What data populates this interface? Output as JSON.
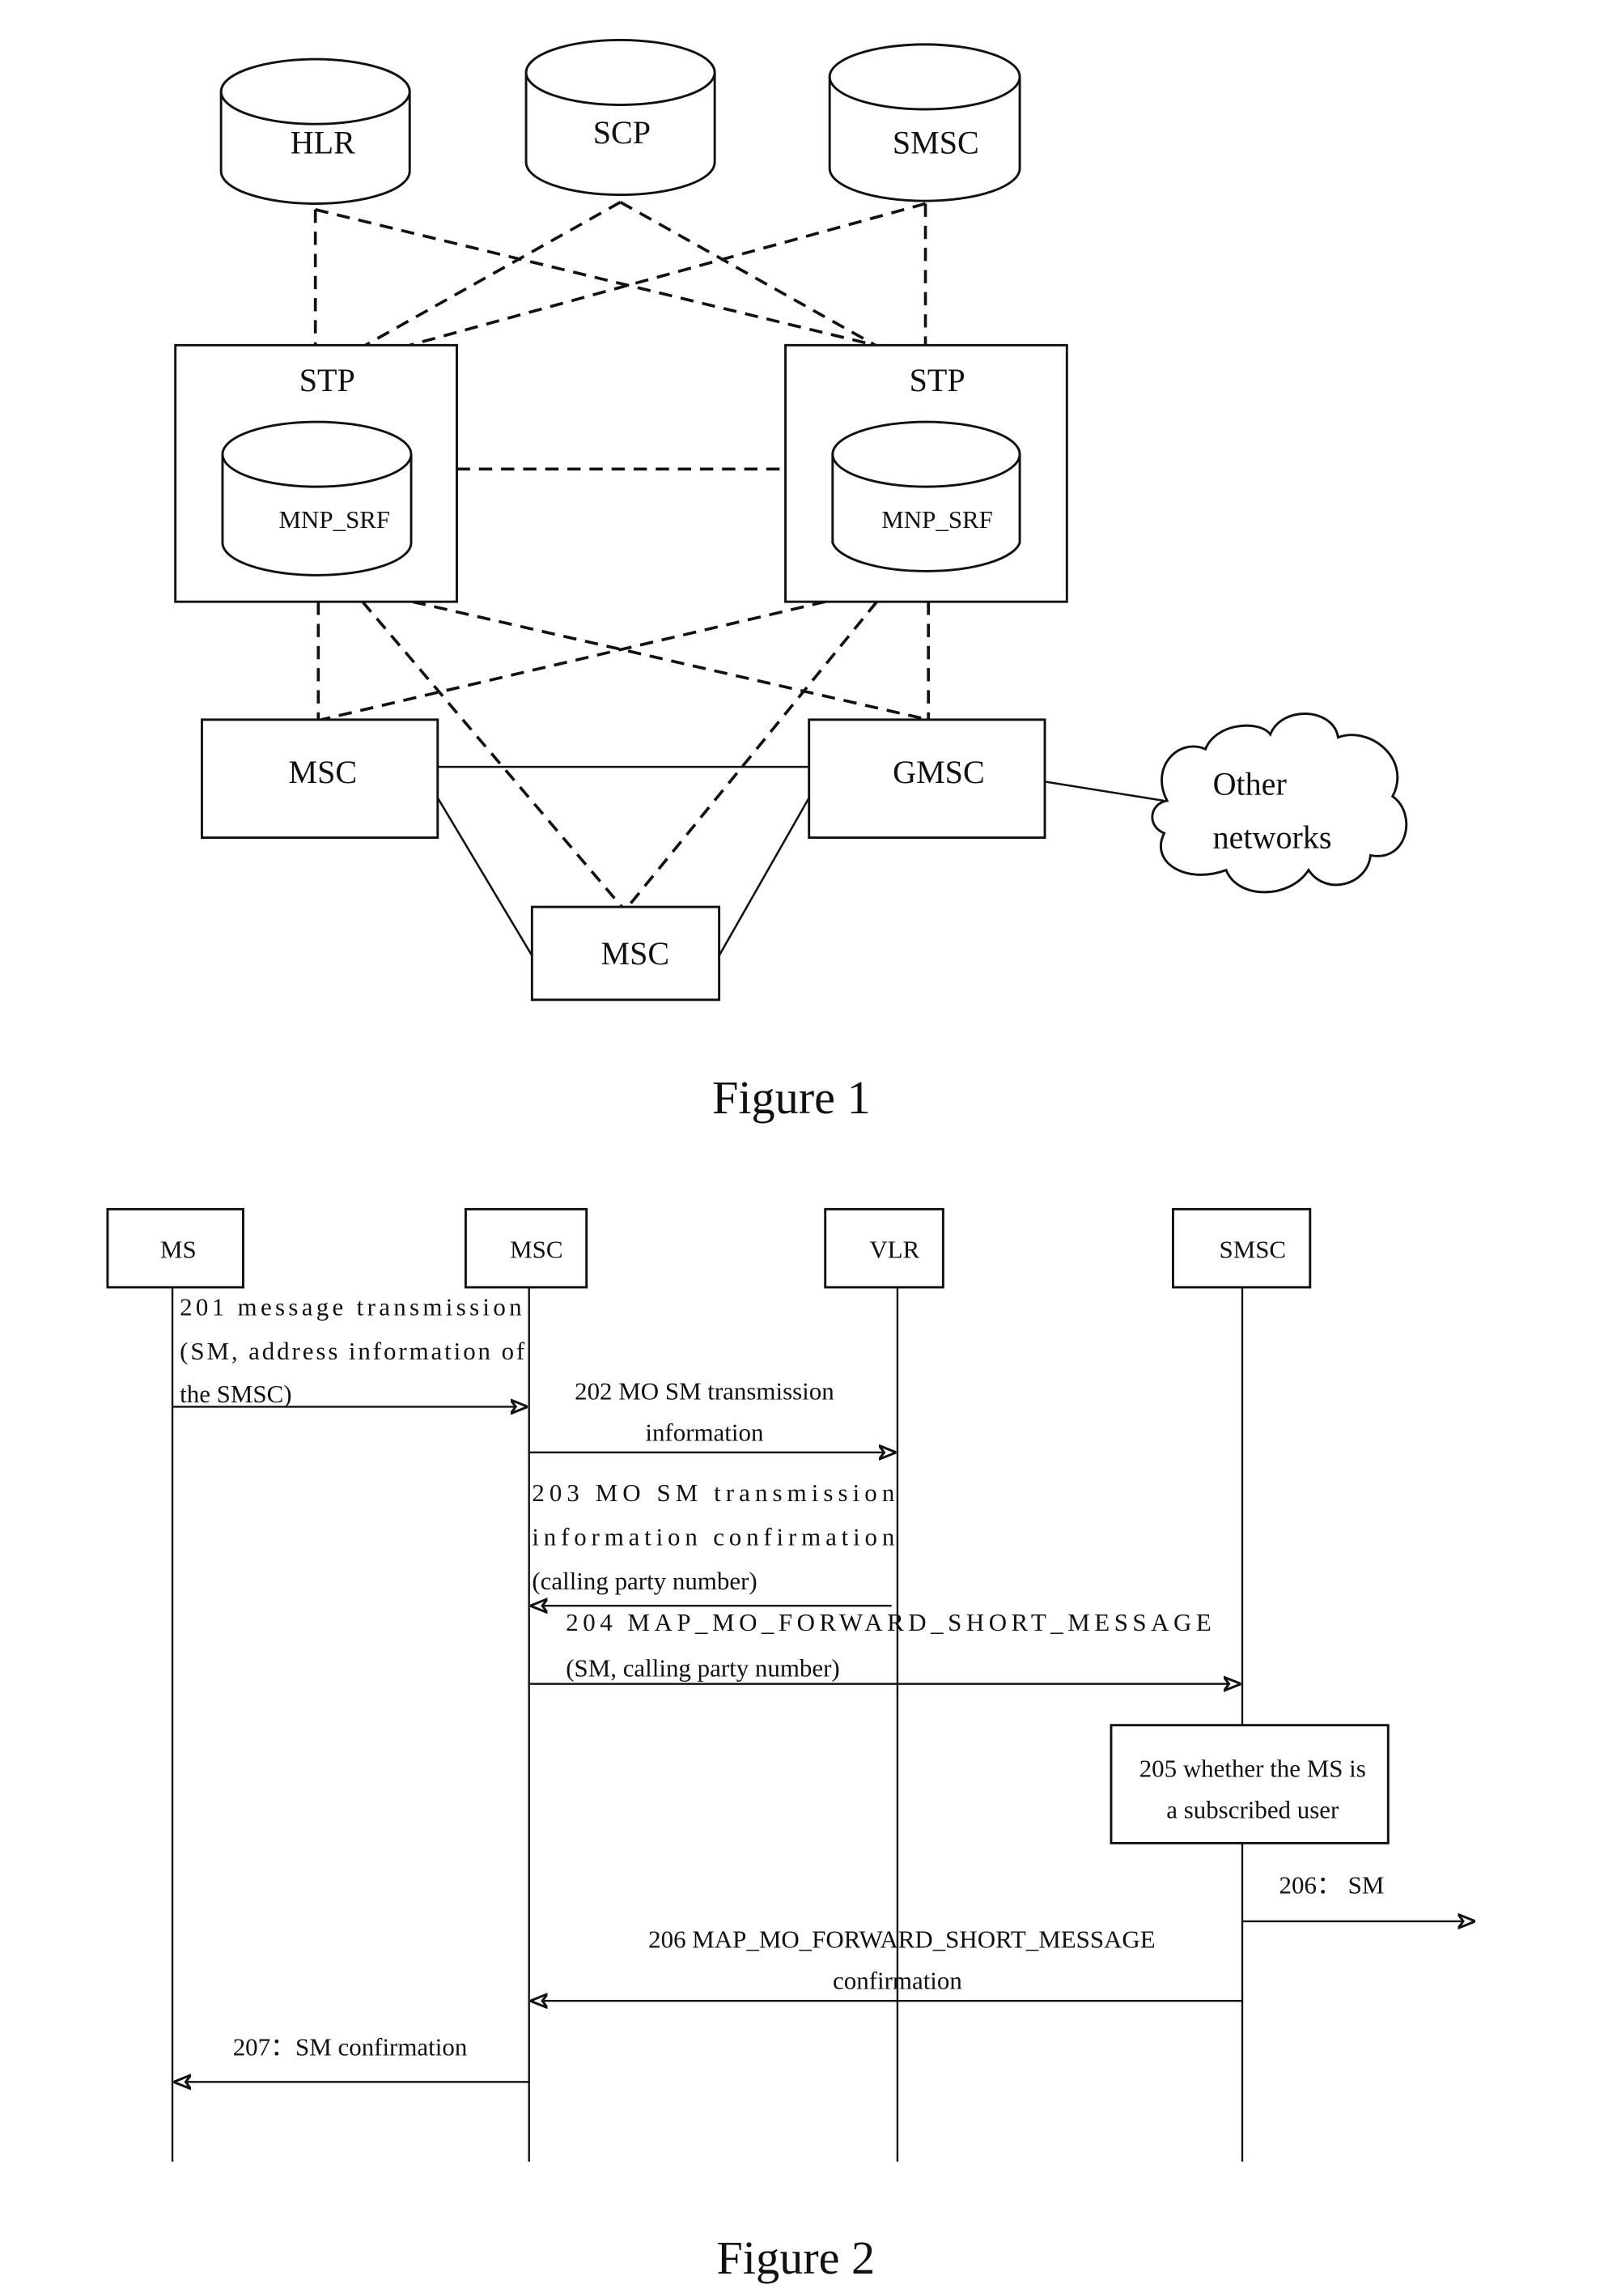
{
  "figure1": {
    "caption": "Figure 1",
    "databases": [
      {
        "id": "hlr",
        "label": "HLR"
      },
      {
        "id": "scp",
        "label": "SCP"
      },
      {
        "id": "smsc",
        "label": "SMSC"
      }
    ],
    "stp_left": {
      "label": "STP",
      "inner_db": "MNP_SRF"
    },
    "stp_right": {
      "label": "STP",
      "inner_db": "MNP_SRF"
    },
    "msc_left": "MSC",
    "gmsc": "GMSC",
    "msc_bottom": "MSC",
    "cloud": {
      "line1": "Other",
      "line2": "networks"
    }
  },
  "figure2": {
    "caption": "Figure 2",
    "participants": [
      "MS",
      "MSC",
      "VLR",
      "SMSC"
    ],
    "messages": {
      "m201": [
        "201    message    transmission",
        "(SM, address information of",
        "the SMSC)"
      ],
      "m202": [
        "202 MO SM transmission",
        "information"
      ],
      "m203": [
        "203     MO    SM    transmission",
        "information           confirmation",
        "(calling party number)"
      ],
      "m204": [
        "204      MAP_MO_FORWARD_SHORT_MESSAGE",
        "(SM, calling party number)"
      ],
      "m205": [
        "205 whether the MS is",
        "a subscribed user"
      ],
      "m206a": "206：  SM",
      "m206b": [
        "206 MAP_MO_FORWARD_SHORT_MESSAGE",
        "confirmation"
      ],
      "m207": "207：SM confirmation"
    }
  }
}
